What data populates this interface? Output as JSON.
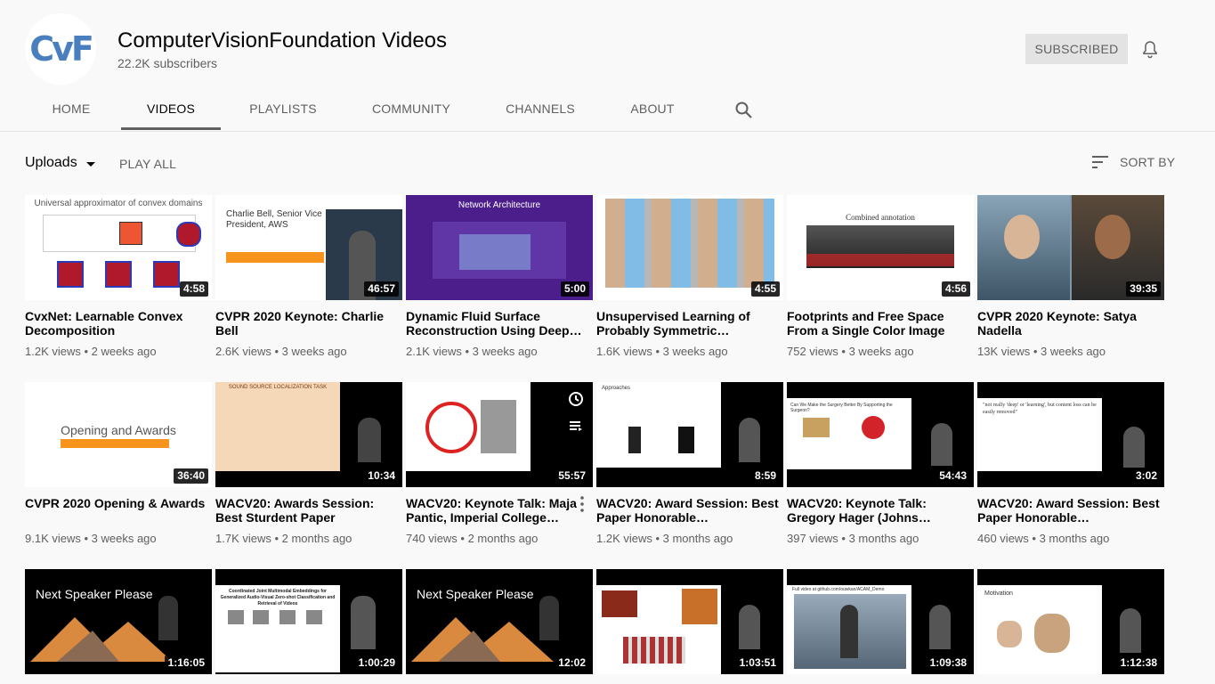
{
  "channel": {
    "logo_text": "CvF",
    "title": "ComputerVisionFoundation Videos",
    "subscribers": "22.2K subscribers",
    "subscribe_label": "SUBSCRIBED"
  },
  "tabs": [
    "HOME",
    "VIDEOS",
    "PLAYLISTS",
    "COMMUNITY",
    "CHANNELS",
    "ABOUT"
  ],
  "toolbar": {
    "uploads_label": "Uploads",
    "play_all_label": "PLAY ALL",
    "sort_by_label": "SORT BY"
  },
  "videos": [
    {
      "title": "CvxNet: Learnable Convex Decomposition",
      "meta": "1.2K views • 2 weeks ago",
      "duration": "4:58",
      "thumb_text": "Universal approximator of convex domains"
    },
    {
      "title": "CVPR 2020 Keynote: Charlie Bell",
      "meta": "2.6K views • 3 weeks ago",
      "duration": "46:57",
      "thumb_text": "Charlie Bell, Senior Vice President, AWS"
    },
    {
      "title": "Dynamic Fluid Surface Reconstruction Using Deep…",
      "meta": "2.1K views • 3 weeks ago",
      "duration": "5:00",
      "thumb_text": "Network Architecture"
    },
    {
      "title": "Unsupervised Learning of Probably Symmetric…",
      "meta": "1.6K views • 3 weeks ago",
      "duration": "4:55",
      "thumb_text": ""
    },
    {
      "title": "Footprints and Free Space From a Single Color Image",
      "meta": "752 views • 3 weeks ago",
      "duration": "4:56",
      "thumb_text": "Combined annotation"
    },
    {
      "title": "CVPR 2020 Keynote: Satya Nadella",
      "meta": "13K views • 3 weeks ago",
      "duration": "39:35",
      "thumb_text": ""
    },
    {
      "title": "CVPR 2020 Opening & Awards",
      "meta": "9.1K views • 3 weeks ago",
      "duration": "36:40",
      "thumb_text": "Opening and Awards"
    },
    {
      "title": "WACV20: Awards Session: Best Sturdent Paper",
      "meta": "1.7K views • 2 months ago",
      "duration": "10:34",
      "thumb_text": "SOUND SOURCE LOCALIZATION TASK"
    },
    {
      "title": "WACV20: Keynote Talk: Maja Pantic, Imperial College…",
      "meta": "740 views • 2 months ago",
      "duration": "55:57",
      "thumb_text": ""
    },
    {
      "title": "WACV20: Award Session: Best Paper Honorable…",
      "meta": "1.2K views • 3 months ago",
      "duration": "8:59",
      "thumb_text": "Approaches"
    },
    {
      "title": "WACV20: Keynote Talk: Gregory Hager (Johns…",
      "meta": "397 views • 3 months ago",
      "duration": "54:43",
      "thumb_text": "Can We Make the Surgery Better By Supporting the Surgeon?"
    },
    {
      "title": "WACV20: Award Session: Best Paper Honorable…",
      "meta": "460 views • 3 months ago",
      "duration": "3:02",
      "thumb_text": "\"not really 'deep' or 'learning', but content loss can be easily removed\""
    },
    {
      "title": "",
      "meta": "",
      "duration": "1:16:05",
      "thumb_text": "Next Speaker Please"
    },
    {
      "title": "",
      "meta": "",
      "duration": "1:00:29",
      "thumb_text": "Coordinated Joint Multimodal Embeddings for Generalized Audio-Visual Zero-shot Classification and Retrieval of Videos"
    },
    {
      "title": "",
      "meta": "",
      "duration": "12:02",
      "thumb_text": "Next Speaker Please"
    },
    {
      "title": "",
      "meta": "",
      "duration": "1:03:51",
      "thumb_text": ""
    },
    {
      "title": "",
      "meta": "",
      "duration": "1:09:38",
      "thumb_text": "Full video at github.com/ouwkan/ACAM_Demo"
    },
    {
      "title": "",
      "meta": "",
      "duration": "1:12:38",
      "thumb_text": "Motivation"
    }
  ],
  "colors": {
    "background": "#f9f9f9",
    "text": "#030303",
    "secondary_text": "#606060",
    "subscribed_bg": "#e3e3e3",
    "logo_blue": "#4a7fbf"
  }
}
